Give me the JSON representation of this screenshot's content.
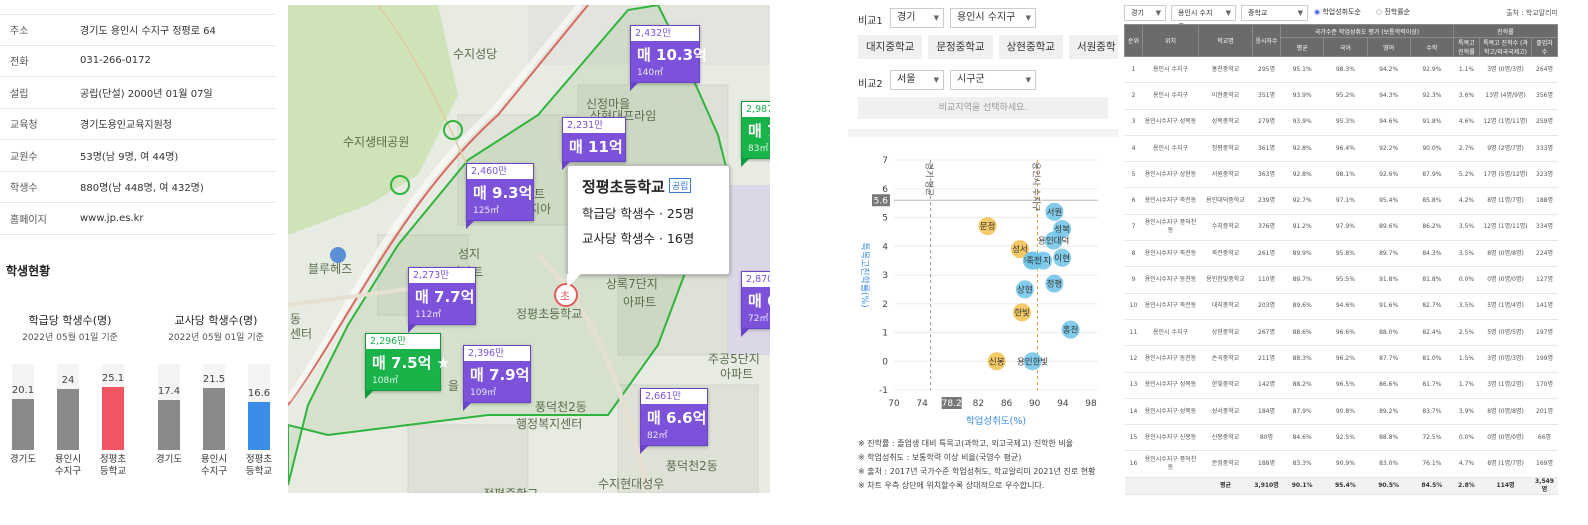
{
  "info": {
    "rows": [
      {
        "k": "주소",
        "v": "경기도 용인시 수지구 정평로 64"
      },
      {
        "k": "전화",
        "v": "031-266-0172"
      },
      {
        "k": "설립",
        "v": "공립(단설) 2000년 01월 07일"
      },
      {
        "k": "교육청",
        "v": "경기도용인교육지원청"
      },
      {
        "k": "교원수",
        "v": "53명(남 9명, 여 44명)"
      },
      {
        "k": "학생수",
        "v": "880명(남 448명, 여 432명)"
      },
      {
        "k": "홈페이지",
        "v": "www.jp.es.kr"
      }
    ],
    "section_title": "학생현황"
  },
  "bar_charts": [
    {
      "title": "학급당 학생수(명)",
      "subtitle": "2022년 05월 01일 기준",
      "max": 34,
      "bars": [
        {
          "label1": "경기도",
          "label2": "",
          "value": 20.1,
          "color": "#8a8a8a"
        },
        {
          "label1": "용인시",
          "label2": "수지구",
          "value": 24,
          "color": "#8a8a8a"
        },
        {
          "label1": "정평초",
          "label2": "등학교",
          "value": 25.1,
          "color": "#f25562"
        }
      ]
    },
    {
      "title": "교사당 학생수(명)",
      "subtitle": "2022년 05월 01일 기준",
      "max": 30,
      "bars": [
        {
          "label1": "경기도",
          "label2": "",
          "value": 17.4,
          "color": "#8a8a8a"
        },
        {
          "label1": "용인시",
          "label2": "수지구",
          "value": 21.5,
          "color": "#8a8a8a"
        },
        {
          "label1": "정평초",
          "label2": "등학교",
          "value": 16.6,
          "color": "#3b8de8"
        }
      ]
    }
  ],
  "map": {
    "labels": [
      "수지성당",
      "수지생태공원",
      "신정마을",
      "블루헤즈",
      "성지",
      "아파트",
      "상록7단지",
      "아파트",
      "정평초등학교",
      "풍덕천2동",
      "행정복지센터",
      "주공5단지",
      "아파트",
      "풍덕천2동",
      "수지현대성우",
      "정평중학교",
      "동",
      "센터",
      "상현대프라임",
      "아파트",
      "단지아",
      "아파트",
      "뜨",
      "을"
    ],
    "markers": [
      {
        "head": "2,432만",
        "price": "매 10.3억",
        "area": "140㎡",
        "green": false
      },
      {
        "head": "2,231만",
        "price": "매 11억",
        "area": "",
        "green": false
      },
      {
        "head": "2,460만",
        "price": "매 9.3억",
        "area": "125㎡",
        "green": false
      },
      {
        "head": "2,273만",
        "price": "매 7.7억",
        "area": "112㎡",
        "green": false
      },
      {
        "head": "2,296만",
        "price": "매 7.5억 ★",
        "area": "108㎡",
        "green": true
      },
      {
        "head": "2,396만",
        "price": "매 7.9억",
        "area": "109㎡",
        "green": false
      },
      {
        "head": "2,661만",
        "price": "매 6.6억",
        "area": "82㎡",
        "green": false
      },
      {
        "head": "2,987",
        "price": "매 7",
        "area": "83㎡",
        "green": true
      },
      {
        "head": "2,870",
        "price": "매 6",
        "area": "72㎡",
        "green": false
      }
    ],
    "tooltip": {
      "name": "정평초등학교",
      "badge": "공립",
      "line1": "학급당 학생수 · 25명",
      "line2": "교사당 학생수 · 16명"
    }
  },
  "compare": {
    "row1_label": "비교1",
    "row1_sel1": "경기",
    "row1_sel2": "용인시 수지구",
    "chips": [
      "대지중학교",
      "문정중학교",
      "상현중학교",
      "서원중학"
    ],
    "row2_label": "비교2",
    "row2_sel1": "서울",
    "row2_sel2": "시구군",
    "row2_placeholder": "비교지역을 선택하세요.",
    "notes": [
      "※ 진학률 : 졸업생 대비 특목고(과학고, 외고국제고) 진학한 비율",
      "※ 학업성취도 : 보통학력 이상 비율(국영수 평균)",
      "※ 출처 : 2017년 국가수준 학업성취도, 학교알리미 2021년 진로 현황",
      "※ 차트 우측 상단에 위치할수록 상대적으로 우수합니다."
    ]
  },
  "chart_data": {
    "type": "scatter",
    "title": "",
    "xlabel": "학업성취도(%)",
    "ylabel": "특목고진학률(%)",
    "xlim": [
      70,
      99
    ],
    "ylim": [
      -1,
      7
    ],
    "xticks": [
      "70",
      "74",
      "78.2",
      "82",
      "86",
      "90",
      "94",
      "98"
    ],
    "yticks": [
      "7",
      "6",
      "5.6",
      "5",
      "4",
      "3",
      "2",
      "1",
      "0",
      "-1"
    ],
    "ref_lines": [
      {
        "axis": "x",
        "value": 75.2,
        "label": "경기 평균"
      },
      {
        "axis": "x",
        "value": 90.4,
        "label": "용인시 수지구"
      },
      {
        "axis": "y",
        "value": 5.6,
        "label": ""
      }
    ],
    "highlight_ticks": {
      "x": "78.2",
      "y": "5.6"
    },
    "points": [
      {
        "label": "문정",
        "x": 83.3,
        "y": 4.7,
        "color": "#f2c04c"
      },
      {
        "label": "서원",
        "x": 92.8,
        "y": 5.2,
        "color": "#6ec3e8"
      },
      {
        "label": "성복",
        "x": 93.9,
        "y": 4.6,
        "color": "#6ec3e8"
      },
      {
        "label": "용인대덕",
        "x": 92.7,
        "y": 4.2,
        "color": "#6ec3e8"
      },
      {
        "label": "성서",
        "x": 87.9,
        "y": 3.9,
        "color": "#f2c04c"
      },
      {
        "label": "이현",
        "x": 93.9,
        "y": 3.6,
        "color": "#6ec3e8"
      },
      {
        "label": "수지",
        "x": 91.2,
        "y": 3.5,
        "color": "#6ec3e8"
      },
      {
        "label": "대지",
        "x": 89.6,
        "y": 3.5,
        "color": "#6ec3e8"
      },
      {
        "label": "죽전",
        "x": 89.9,
        "y": 3.5,
        "color": "#6ec3e8"
      },
      {
        "label": "상현",
        "x": 88.6,
        "y": 2.5,
        "color": "#6ec3e8"
      },
      {
        "label": "정평",
        "x": 92.8,
        "y": 2.7,
        "color": "#6ec3e8"
      },
      {
        "label": "홍천",
        "x": 95.1,
        "y": 1.1,
        "color": "#6ec3e8"
      },
      {
        "label": "한빛",
        "x": 88.2,
        "y": 1.7,
        "color": "#f2c04c"
      },
      {
        "label": "신봉",
        "x": 84.6,
        "y": 0.0,
        "color": "#f2c04c"
      },
      {
        "label": "용인한빛",
        "x": 89.7,
        "y": 0.0,
        "color": "#6ec3e8"
      }
    ]
  },
  "table": {
    "filter_sel1": "경기",
    "filter_sel2": "용인시 수지구",
    "filter_sel3": "중학교",
    "radio1": "학업성취도순",
    "radio2": "진학률순",
    "source": "출처 : 학교알리미",
    "head_group1": "국가수준 학업성취도 평가 (보통학력이상)",
    "head_group2": "진학률",
    "headers": [
      "순위",
      "위치",
      "학교명",
      "응시자수",
      "평균",
      "국어",
      "영어",
      "수학",
      "특목고 진학률",
      "특목고 진학수 (과학고/외국국제고)",
      "졸업자 수"
    ],
    "rows": [
      [
        "1",
        "용인시 수지구",
        "홍천중학교",
        "295명",
        "95.1%",
        "98.3%",
        "94.2%",
        "92.9%",
        "1.1%",
        "3명 (0명/3명)",
        "264명"
      ],
      [
        "2",
        "용인시 수지구",
        "이현중학교",
        "351명",
        "93.9%",
        "95.2%",
        "94.3%",
        "92.3%",
        "3.6%",
        "13명 (4명/9명)",
        "356명"
      ],
      [
        "3",
        "용인시수지구 성복동",
        "성복중학교",
        "279명",
        "93.9%",
        "95.3%",
        "94.6%",
        "91.8%",
        "4.6%",
        "12명 (1명/11명)",
        "259명"
      ],
      [
        "4",
        "용인시 수지구",
        "정평중학교",
        "361명",
        "92.8%",
        "96.4%",
        "92.2%",
        "90.0%",
        "2.7%",
        "9명 (2명/7명)",
        "333명"
      ],
      [
        "5",
        "용인시수지구 상현동",
        "서원중학교",
        "363명",
        "92.8%",
        "98.1%",
        "92.6%",
        "87.9%",
        "5.2%",
        "17명 (5명/12명)",
        "323명"
      ],
      [
        "6",
        "용인시수지구 죽전동",
        "용인대덕중학교",
        "239명",
        "92.7%",
        "97.1%",
        "95.4%",
        "85.8%",
        "4.2%",
        "8명 (1명/7명)",
        "188명"
      ],
      [
        "7",
        "용인시수지구 풍덕천동",
        "수지중학교",
        "376명",
        "91.2%",
        "97.9%",
        "89.6%",
        "86.2%",
        "3.5%",
        "12명 (1명/11명)",
        "334명"
      ],
      [
        "8",
        "용인시수지구 죽전동",
        "죽전중학교",
        "261명",
        "89.9%",
        "95.8%",
        "89.7%",
        "84.3%",
        "3.5%",
        "8명 (0명/8명)",
        "224명"
      ],
      [
        "9",
        "용인시수지구 동천동",
        "용인한빛중학교",
        "110명",
        "89.7%",
        "95.5%",
        "91.8%",
        "81.8%",
        "0.0%",
        "0명 (0명/0명)",
        "127명"
      ],
      [
        "10",
        "용인시수지구 죽전동",
        "대지중학교",
        "203명",
        "89.6%",
        "94.6%",
        "91.6%",
        "82.7%",
        "3.5%",
        "5명 (1명/4명)",
        "141명"
      ],
      [
        "11",
        "용인시 수지구",
        "상현중학교",
        "267명",
        "88.6%",
        "96.6%",
        "88.0%",
        "82.4%",
        "2.5%",
        "5명 (0명/5명)",
        "197명"
      ],
      [
        "12",
        "용인시수지구 동천동",
        "손곡중학교",
        "211명",
        "88.3%",
        "96.2%",
        "87.7%",
        "81.0%",
        "1.5%",
        "3명 (0명/3명)",
        "199명"
      ],
      [
        "13",
        "용인시수지구 성복동",
        "한빛중학교",
        "142명",
        "88.2%",
        "96.5%",
        "86.6%",
        "81.7%",
        "1.7%",
        "3명 (1명/2명)",
        "170명"
      ],
      [
        "14",
        "용인시수지구 성복동",
        "성서중학교",
        "184명",
        "87.9%",
        "90.8%",
        "89.2%",
        "83.7%",
        "3.9%",
        "8명 (0명/8명)",
        "201명"
      ],
      [
        "15",
        "용인시수지구 신봉동",
        "신봉중학교",
        "80명",
        "84.6%",
        "92.5%",
        "88.8%",
        "72.5%",
        "0.0%",
        "0명 (0명/0명)",
        "66명"
      ],
      [
        "16",
        "용인시수지구 풍덕천동",
        "문정중학교",
        "188명",
        "83.3%",
        "90.9%",
        "83.0%",
        "76.1%",
        "4.7%",
        "8명 (1명/7명)",
        "169명"
      ]
    ],
    "avg": [
      "",
      "",
      "평균",
      "3,910명",
      "90.1%",
      "95.4%",
      "90.5%",
      "84.5%",
      "2.8%",
      "114명",
      "3,549명"
    ]
  }
}
